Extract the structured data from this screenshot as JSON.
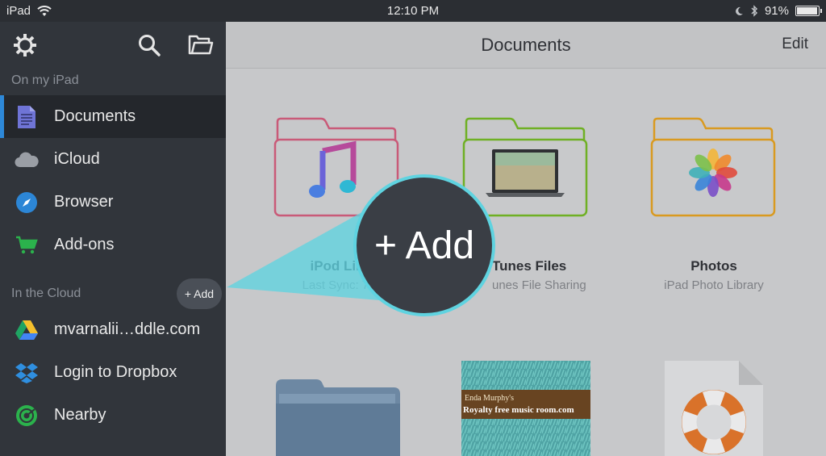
{
  "statusbar": {
    "device": "iPad",
    "time": "12:10 PM",
    "battery": "91%"
  },
  "sidebar": {
    "section_local": "On my iPad",
    "section_cloud": "In the Cloud",
    "local_items": [
      {
        "label": "Documents"
      },
      {
        "label": "iCloud"
      },
      {
        "label": "Browser"
      },
      {
        "label": "Add-ons"
      }
    ],
    "cloud_items": [
      {
        "label": "mvarnalii…ddle.com"
      },
      {
        "label": "Login to Dropbox"
      },
      {
        "label": "Nearby"
      }
    ],
    "add_label": "+ Add"
  },
  "navbar": {
    "title": "Documents",
    "edit": "Edit"
  },
  "tiles": [
    {
      "name": "iPod Lib",
      "sub": "Last Sync: 7/"
    },
    {
      "name": "Tunes Files",
      "sub": "unes File Sharing"
    },
    {
      "name": "Photos",
      "sub": "iPad Photo Library"
    }
  ],
  "thumbnail_text": {
    "line1": "Enda Murphy's",
    "line2": "Royalty free music room.com"
  },
  "callout": {
    "label": "+ Add"
  },
  "colors": {
    "accent": "#2d88d8",
    "callout_border": "#5fd3e0"
  }
}
